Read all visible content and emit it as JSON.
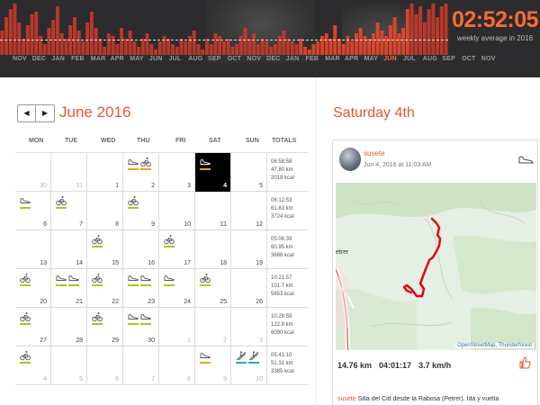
{
  "header": {
    "average_time": "02:52:05",
    "average_label": "weekly average in 2016",
    "months": [
      "NOV",
      "DEC",
      "JAN",
      "FEB",
      "MAR",
      "APR",
      "MAY",
      "JUN",
      "JUL",
      "AUG",
      "SEP",
      "OCT",
      "NOV",
      "DEC",
      "JAN",
      "FEB",
      "MAR",
      "APR",
      "MAY",
      "JUN",
      "JUL",
      "AUG",
      "SEP",
      "OCT",
      "NOV"
    ],
    "highlight_month_index": 19,
    "accent_color": "#ff6a2f",
    "weekly_bars": [
      0.45,
      0.7,
      0.85,
      0.95,
      0.6,
      0.3,
      0.55,
      0.75,
      0.8,
      0.35,
      0.2,
      0.5,
      0.65,
      0.9,
      0.4,
      0.3,
      0.55,
      0.7,
      0.45,
      0.25,
      0.6,
      0.8,
      0.5,
      0.3,
      0.15,
      0.4,
      0.35,
      0.2,
      0.5,
      0.3,
      0.45,
      0.25,
      0.15,
      0.3,
      0.4,
      0.2,
      0.1,
      0.25,
      0.35,
      0.3,
      0.2,
      0.15,
      0.3,
      0.25,
      0.35,
      0.45,
      0.2,
      0.1,
      0.3,
      0.2,
      0.4,
      0.35,
      0.25,
      0.3,
      0.15,
      0.2,
      0.35,
      0.5,
      0.3,
      0.4,
      0.2,
      0.3,
      0.25,
      0.15,
      0.2,
      0.35,
      0.45,
      0.3,
      0.25,
      0.2,
      0.3,
      0.15,
      0.1,
      0.2,
      0.25,
      0.35,
      0.4,
      0.3,
      0.55,
      0.3,
      0.2,
      0.35,
      0.25,
      0.4,
      0.5,
      0.35,
      0.3,
      0.4,
      0.6,
      0.45,
      0.35,
      0.55,
      0.7,
      0.4,
      0.5,
      0.85,
      0.95,
      0.75,
      0.9,
      0.6,
      0.85,
      0.95,
      0.7,
      0.9,
      0.95
    ],
    "average_level": 0.3
  },
  "calendar": {
    "month_title": "June 2016",
    "prev_label": "◀",
    "next_label": "▶",
    "weekday_headers": [
      "MON",
      "TUE",
      "WED",
      "THU",
      "FRI",
      "SAT",
      "SUN",
      "TOTALS"
    ],
    "weeks": [
      {
        "days": [
          {
            "num": "30",
            "other": true,
            "acts": []
          },
          {
            "num": "31",
            "other": true,
            "acts": []
          },
          {
            "num": "1",
            "acts": []
          },
          {
            "num": "2",
            "acts": [
              {
                "type": "shoe",
                "color": "#f0a500"
              },
              {
                "type": "bike",
                "color": "#f0a500"
              }
            ]
          },
          {
            "num": "3",
            "acts": []
          },
          {
            "num": "4",
            "selected": true,
            "acts": [
              {
                "type": "shoe",
                "color": "#f0a500"
              }
            ]
          },
          {
            "num": "5",
            "acts": []
          }
        ],
        "totals": [
          "06:58:58",
          "47.80 km",
          "2018 kcal"
        ]
      },
      {
        "days": [
          {
            "num": "6",
            "acts": [
              {
                "type": "shoe",
                "color": "#a8c914"
              }
            ]
          },
          {
            "num": "7",
            "acts": [
              {
                "type": "bike",
                "color": "#a8c914"
              }
            ]
          },
          {
            "num": "8",
            "acts": []
          },
          {
            "num": "9",
            "acts": [
              {
                "type": "bike",
                "color": "#a8c914"
              }
            ]
          },
          {
            "num": "10",
            "acts": []
          },
          {
            "num": "11",
            "acts": []
          },
          {
            "num": "12",
            "acts": []
          }
        ],
        "totals": [
          "06:12:53",
          "61.83 km",
          "3724 kcal"
        ]
      },
      {
        "days": [
          {
            "num": "13",
            "acts": []
          },
          {
            "num": "14",
            "acts": []
          },
          {
            "num": "15",
            "acts": [
              {
                "type": "bike",
                "color": "#a8c914"
              }
            ]
          },
          {
            "num": "16",
            "acts": []
          },
          {
            "num": "17",
            "acts": [
              {
                "type": "bike",
                "color": "#a8c914"
              }
            ]
          },
          {
            "num": "18",
            "acts": []
          },
          {
            "num": "19",
            "acts": []
          }
        ],
        "totals": [
          "05:06:39",
          "60.95 km",
          "3686 kcal"
        ]
      },
      {
        "days": [
          {
            "num": "20",
            "acts": [
              {
                "type": "bike",
                "color": "#a8c914"
              }
            ]
          },
          {
            "num": "21",
            "acts": [
              {
                "type": "shoe",
                "color": "#a8c914"
              },
              {
                "type": "shoe",
                "color": "#a8c914"
              }
            ]
          },
          {
            "num": "22",
            "acts": [
              {
                "type": "bike",
                "color": "#a8c914"
              }
            ]
          },
          {
            "num": "23",
            "acts": [
              {
                "type": "shoe",
                "color": "#a8c914"
              },
              {
                "type": "shoe",
                "color": "#a8c914"
              }
            ]
          },
          {
            "num": "24",
            "acts": [
              {
                "type": "shoe",
                "color": "#a8c914"
              }
            ]
          },
          {
            "num": "25",
            "acts": [
              {
                "type": "bike",
                "color": "#a8c914"
              }
            ]
          },
          {
            "num": "26",
            "acts": []
          }
        ],
        "totals": [
          "10:21:57",
          "101.7 km",
          "5653 kcal"
        ]
      },
      {
        "days": [
          {
            "num": "27",
            "acts": [
              {
                "type": "bike",
                "color": "#a8c914"
              }
            ]
          },
          {
            "num": "28",
            "acts": []
          },
          {
            "num": "29",
            "acts": [
              {
                "type": "bike",
                "color": "#a8c914"
              }
            ]
          },
          {
            "num": "30",
            "acts": [
              {
                "type": "shoe",
                "color": "#a8c914"
              },
              {
                "type": "shoe",
                "color": "#a8c914"
              }
            ]
          },
          {
            "num": "1",
            "other": true,
            "acts": []
          },
          {
            "num": "2",
            "other": true,
            "acts": []
          },
          {
            "num": "3",
            "other": true,
            "acts": []
          }
        ],
        "totals": [
          "10:28:59",
          "122.8 km",
          "6090 kcal"
        ]
      },
      {
        "days": [
          {
            "num": "4",
            "other": true,
            "acts": [
              {
                "type": "bike",
                "color": "#a8c914"
              }
            ]
          },
          {
            "num": "5",
            "other": true,
            "acts": []
          },
          {
            "num": "6",
            "other": true,
            "acts": []
          },
          {
            "num": "7",
            "other": true,
            "acts": []
          },
          {
            "num": "8",
            "other": true,
            "acts": []
          },
          {
            "num": "9",
            "other": true,
            "acts": [
              {
                "type": "shoe",
                "color": "#f0a500"
              }
            ]
          },
          {
            "num": "10",
            "other": true,
            "acts": [
              {
                "type": "ski",
                "color": "#2aa7d8"
              },
              {
                "type": "ski",
                "color": "#2aa7d8"
              }
            ]
          }
        ],
        "totals": [
          "05:41:10",
          "51.31 km",
          "3385 kcal"
        ]
      }
    ]
  },
  "activity": {
    "day_title": "Saturday 4th",
    "user": "susete",
    "date": "Jun 4, 2016 at 11:03 AM",
    "map_town": "etrer",
    "map_attribution": "OpenStreetMap, Thunderforest",
    "distance": "14.76 km",
    "duration": "04:01:17",
    "speed": "3.7 km/h",
    "name": "Silla del Cid desde la Rabosa (Petrer). Ida y vuelta",
    "route_color": "#e8001c"
  }
}
